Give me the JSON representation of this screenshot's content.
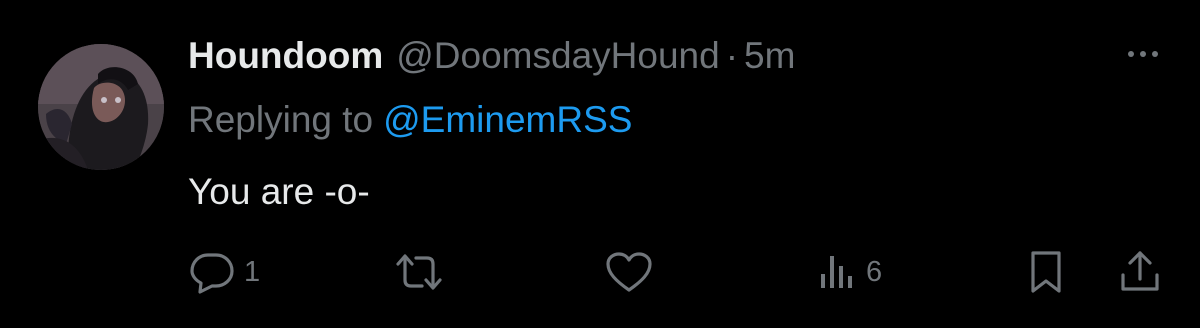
{
  "tweet": {
    "author": {
      "display_name": "Houndoom",
      "handle": "@DoomsdayHound",
      "avatar": "avatar-image"
    },
    "separator": "·",
    "timestamp": "5m",
    "more_icon": "more-horizontal-icon",
    "replying_prefix": "Replying to",
    "replying_to": "@EminemRSS",
    "text": "You are -o-"
  },
  "actions": {
    "reply": {
      "icon": "reply-icon",
      "count": "1"
    },
    "retweet": {
      "icon": "retweet-icon",
      "count": ""
    },
    "like": {
      "icon": "heart-icon",
      "count": ""
    },
    "views": {
      "icon": "views-icon",
      "count": "6"
    },
    "bookmark": {
      "icon": "bookmark-icon"
    },
    "share": {
      "icon": "share-icon"
    }
  },
  "colors": {
    "background": "#000000",
    "primary_text": "#e7e9ea",
    "secondary_text": "#71767b",
    "link": "#1d9bf0"
  }
}
